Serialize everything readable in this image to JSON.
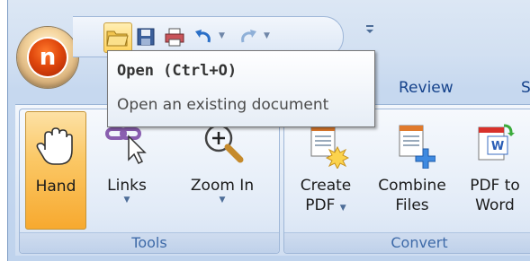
{
  "quick_access": {
    "buttons": [
      "open-icon",
      "save-icon",
      "print-icon",
      "undo-icon",
      "redo-icon"
    ]
  },
  "tabs": [
    "Review",
    "Se"
  ],
  "tooltip": {
    "title": "Open (Ctrl+O)",
    "description": "Open an existing document"
  },
  "ribbon": {
    "groups": [
      {
        "label": "Tools",
        "buttons": [
          {
            "label": "Hand",
            "pressed": true
          },
          {
            "label": "Links",
            "dropdown": true
          },
          {
            "label": "Zoom In",
            "dropdown": true
          }
        ]
      },
      {
        "label": "Convert",
        "buttons": [
          {
            "label_line1": "Create",
            "label_line2": "PDF",
            "dropdown": true
          },
          {
            "label_line1": "Combine",
            "label_line2": "Files"
          },
          {
            "label_line1": "PDF to",
            "label_line2": "Word"
          }
        ]
      }
    ]
  },
  "colors": {
    "accent": "#15428b",
    "pressed": "#fbc866",
    "group_label": "#3e6aa8"
  }
}
